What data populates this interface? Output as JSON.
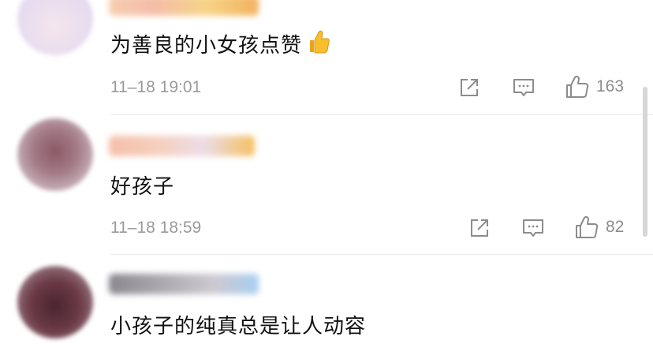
{
  "comments": [
    {
      "text": "为善良的小女孩点赞",
      "emoji": "thumbs-up-emoji",
      "timestamp": "11–18 19:01",
      "like_count": "163"
    },
    {
      "text": "好孩子",
      "timestamp": "11–18 18:59",
      "like_count": "82"
    },
    {
      "text": "小孩子的纯真总是让人动容"
    }
  ],
  "icons": {
    "share": "share-icon",
    "comment": "comment-icon",
    "like": "like-thumb-icon"
  },
  "colors": {
    "text": "#111111",
    "meta": "#9a9a9a",
    "divider": "#ececec"
  }
}
